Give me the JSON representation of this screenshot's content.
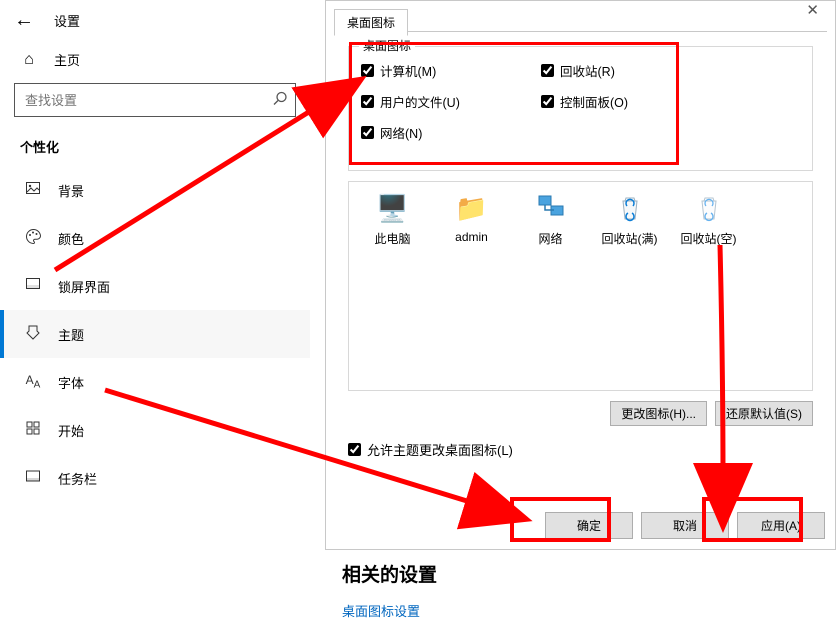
{
  "topbar": {
    "title": "设置"
  },
  "home": {
    "label": "主页"
  },
  "search": {
    "placeholder": "查找设置"
  },
  "section": {
    "title": "个性化"
  },
  "sidebar": {
    "items": [
      {
        "icon": "image-icon",
        "label": "背景"
      },
      {
        "icon": "palette-icon",
        "label": "颜色"
      },
      {
        "icon": "lockscreen-icon",
        "label": "锁屏界面"
      },
      {
        "icon": "theme-icon",
        "label": "主题"
      },
      {
        "icon": "font-icon",
        "label": "字体"
      },
      {
        "icon": "start-icon",
        "label": "开始"
      },
      {
        "icon": "taskbar-icon",
        "label": "任务栏"
      }
    ],
    "active_index": 3
  },
  "dialog": {
    "tab": "桌面图标",
    "group_title": "桌面图标",
    "checks": {
      "computer": {
        "label": "计算机(M)",
        "checked": true
      },
      "recycle": {
        "label": "回收站(R)",
        "checked": true
      },
      "userdocs": {
        "label": "用户的文件(U)",
        "checked": true
      },
      "ctrlpanel": {
        "label": "控制面板(O)",
        "checked": true
      },
      "network": {
        "label": "网络(N)",
        "checked": true
      }
    },
    "preview": [
      {
        "name": "此电脑",
        "iconName": "computer-icon",
        "glyph": "🖥️"
      },
      {
        "name": "admin",
        "iconName": "user-folder-icon",
        "glyph": "📁"
      },
      {
        "name": "网络",
        "iconName": "network-icon",
        "glyph": "🖧"
      },
      {
        "name": "回收站(满)",
        "iconName": "recycle-full-icon",
        "glyph": "🗑️"
      },
      {
        "name": "回收站(空)",
        "iconName": "recycle-empty-icon",
        "glyph": "🗑️"
      }
    ],
    "change_icon_btn": "更改图标(H)...",
    "restore_btn": "还原默认值(S)",
    "allow_themes": {
      "label": "允许主题更改桌面图标(L)",
      "checked": true
    },
    "ok_btn": "确定",
    "cancel_btn": "取消",
    "apply_btn": "应用(A)"
  },
  "related": {
    "title": "相关的设置",
    "link": "桌面图标设置"
  }
}
